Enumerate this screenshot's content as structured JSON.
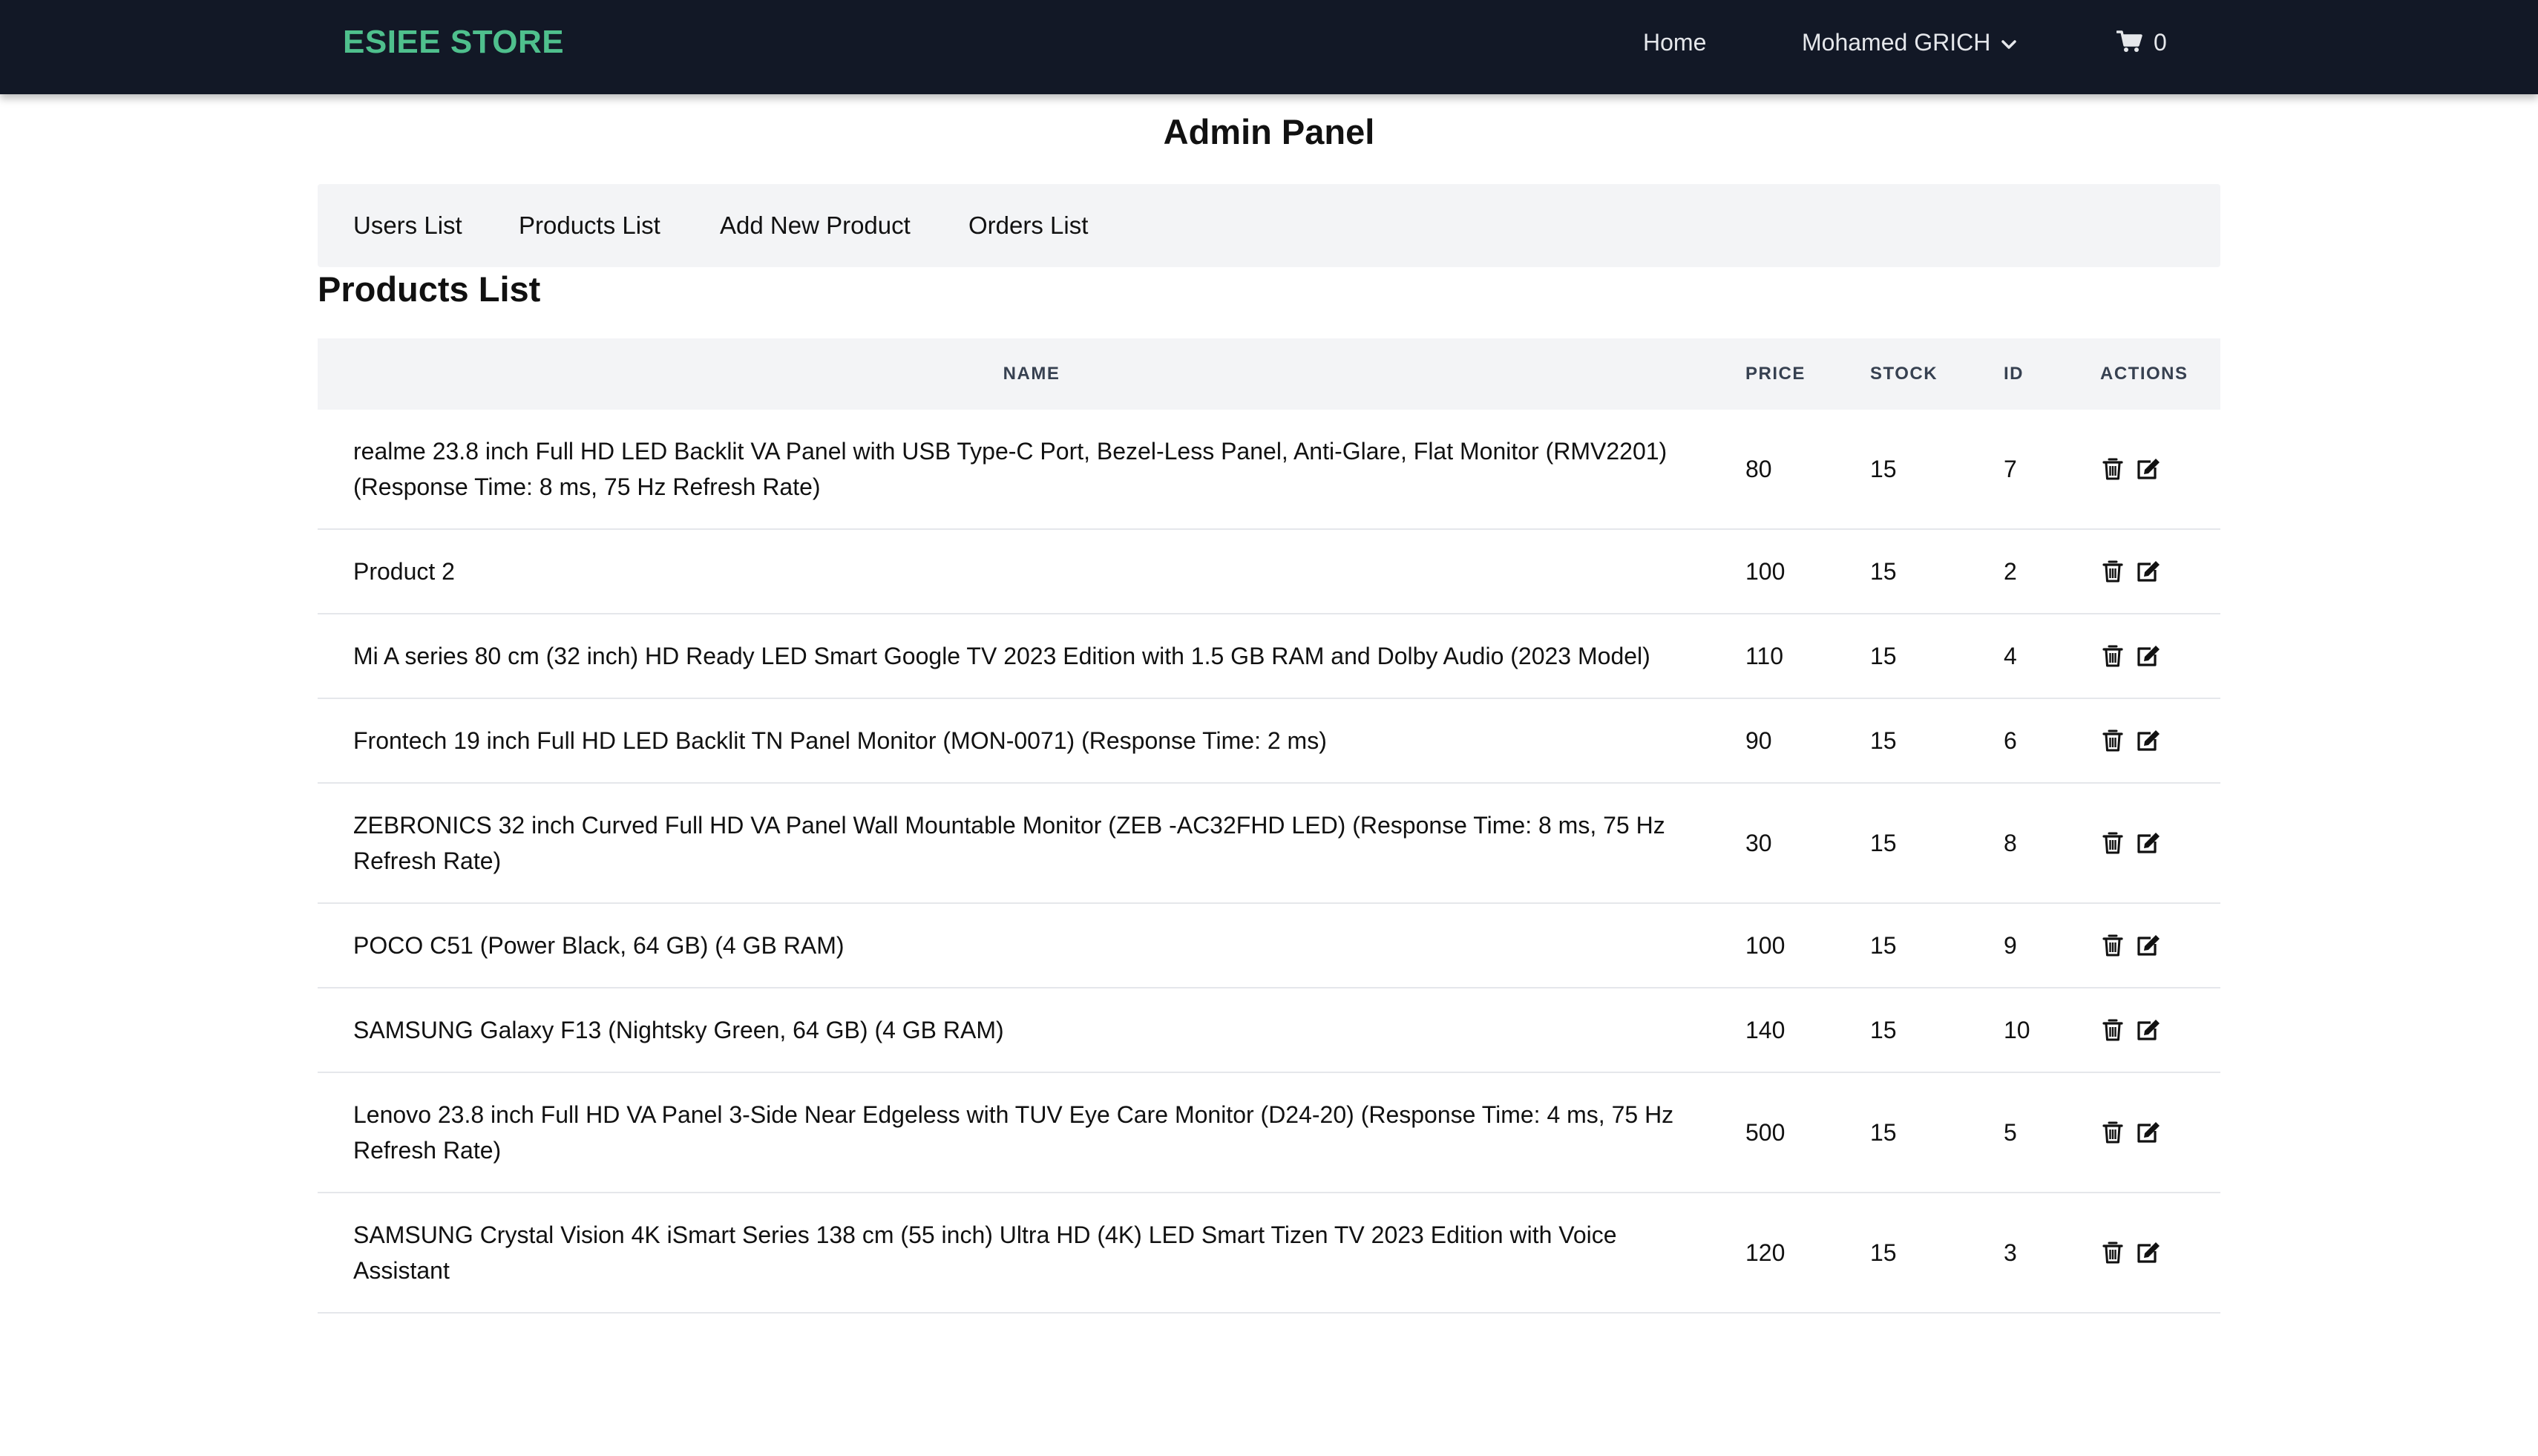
{
  "navbar": {
    "brand": "ESIEE STORE",
    "home": "Home",
    "user": "Mohamed GRICH",
    "cart_count": "0"
  },
  "page_title": "Admin Panel",
  "tabs": [
    {
      "label": "Users List"
    },
    {
      "label": "Products List"
    },
    {
      "label": "Add New Product"
    },
    {
      "label": "Orders List"
    }
  ],
  "section_title": "Products List",
  "table": {
    "headers": {
      "name": "NAME",
      "price": "PRICE",
      "stock": "STOCK",
      "id": "ID",
      "actions": "ACTIONS"
    },
    "rows": [
      {
        "name": "realme 23.8 inch Full HD LED Backlit VA Panel with USB Type-C Port, Bezel-Less Panel, Anti-Glare, Flat Monitor (RMV2201) (Response Time: 8 ms, 75 Hz Refresh Rate)",
        "price": "80",
        "stock": "15",
        "id": "7"
      },
      {
        "name": "Product 2",
        "price": "100",
        "stock": "15",
        "id": "2"
      },
      {
        "name": "Mi A series 80 cm (32 inch) HD Ready LED Smart Google TV 2023 Edition with 1.5 GB RAM and Dolby Audio (2023 Model)",
        "price": "110",
        "stock": "15",
        "id": "4"
      },
      {
        "name": "Frontech 19 inch Full HD LED Backlit TN Panel Monitor (MON-0071) (Response Time: 2 ms)",
        "price": "90",
        "stock": "15",
        "id": "6"
      },
      {
        "name": "ZEBRONICS 32 inch Curved Full HD VA Panel Wall Mountable Monitor (ZEB -AC32FHD LED) (Response Time: 8 ms, 75 Hz Refresh Rate)",
        "price": "30",
        "stock": "15",
        "id": "8"
      },
      {
        "name": "POCO C51 (Power Black, 64 GB) (4 GB RAM)",
        "price": "100",
        "stock": "15",
        "id": "9"
      },
      {
        "name": "SAMSUNG Galaxy F13 (Nightsky Green, 64 GB) (4 GB RAM)",
        "price": "140",
        "stock": "15",
        "id": "10"
      },
      {
        "name": "Lenovo 23.8 inch Full HD VA Panel 3-Side Near Edgeless with TUV Eye Care Monitor (D24-20) (Response Time: 4 ms, 75 Hz Refresh Rate)",
        "price": "500",
        "stock": "15",
        "id": "5"
      },
      {
        "name": "SAMSUNG Crystal Vision 4K iSmart Series 138 cm (55 inch) Ultra HD (4K) LED Smart Tizen TV 2023 Edition with Voice Assistant",
        "price": "120",
        "stock": "15",
        "id": "3"
      }
    ]
  },
  "icons": {
    "delete": "trash-icon",
    "edit": "edit-icon",
    "cart": "cart-icon",
    "dropdown": "chevron-down-icon"
  },
  "colors": {
    "navbar_bg": "#121826",
    "brand": "#4fc08d",
    "tabs_bg": "#f3f4f6",
    "row_border": "#e5e7eb"
  }
}
